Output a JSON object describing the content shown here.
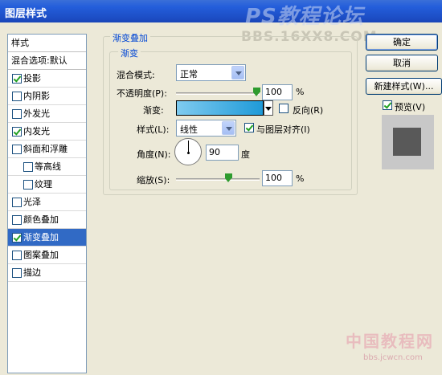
{
  "window": {
    "title": "图层样式",
    "watermark_top": "PS教程论坛",
    "watermark_bbs": "BBS.16XX8.COM"
  },
  "left_panel": {
    "header": "样式",
    "blend_options": "混合选项:默认",
    "items": [
      {
        "label": "投影",
        "checked": true,
        "indent": false,
        "selected": false
      },
      {
        "label": "内阴影",
        "checked": false,
        "indent": false,
        "selected": false
      },
      {
        "label": "外发光",
        "checked": false,
        "indent": false,
        "selected": false
      },
      {
        "label": "内发光",
        "checked": true,
        "indent": false,
        "selected": false
      },
      {
        "label": "斜面和浮雕",
        "checked": false,
        "indent": false,
        "selected": false
      },
      {
        "label": "等高线",
        "checked": false,
        "indent": true,
        "selected": false
      },
      {
        "label": "纹理",
        "checked": false,
        "indent": true,
        "selected": false
      },
      {
        "label": "光泽",
        "checked": false,
        "indent": false,
        "selected": false
      },
      {
        "label": "颜色叠加",
        "checked": false,
        "indent": false,
        "selected": false
      },
      {
        "label": "渐变叠加",
        "checked": true,
        "indent": false,
        "selected": true
      },
      {
        "label": "图案叠加",
        "checked": false,
        "indent": false,
        "selected": false
      },
      {
        "label": "描边",
        "checked": false,
        "indent": false,
        "selected": false
      }
    ]
  },
  "gradient_overlay": {
    "section_title": "渐变叠加",
    "group_title": "渐变",
    "blend_mode_label": "混合模式:",
    "blend_mode_value": "正常",
    "opacity_label": "不透明度(P):",
    "opacity_value": "100",
    "opacity_unit": "%",
    "opacity_slider_fraction": 1.0,
    "gradient_label": "渐变:",
    "gradient_colors": [
      "#7fcbf0",
      "#1f9ad8"
    ],
    "reverse_label": "反向(R)",
    "reverse_checked": false,
    "style_label": "样式(L):",
    "style_value": "线性",
    "align_label": "与图层对齐(I)",
    "align_checked": true,
    "angle_label": "角度(N):",
    "angle_value": "90",
    "angle_unit": "度",
    "scale_label": "缩放(S):",
    "scale_value": "100",
    "scale_unit": "%",
    "scale_slider_fraction": 0.625
  },
  "right_panel": {
    "ok_label": "确定",
    "cancel_label": "取消",
    "new_style_label": "新建样式(W)...",
    "preview_label": "预览(V)",
    "preview_checked": true
  },
  "bottom_watermark": {
    "line1": "中国教程网",
    "line2": "bbs.jcwcn.com"
  }
}
